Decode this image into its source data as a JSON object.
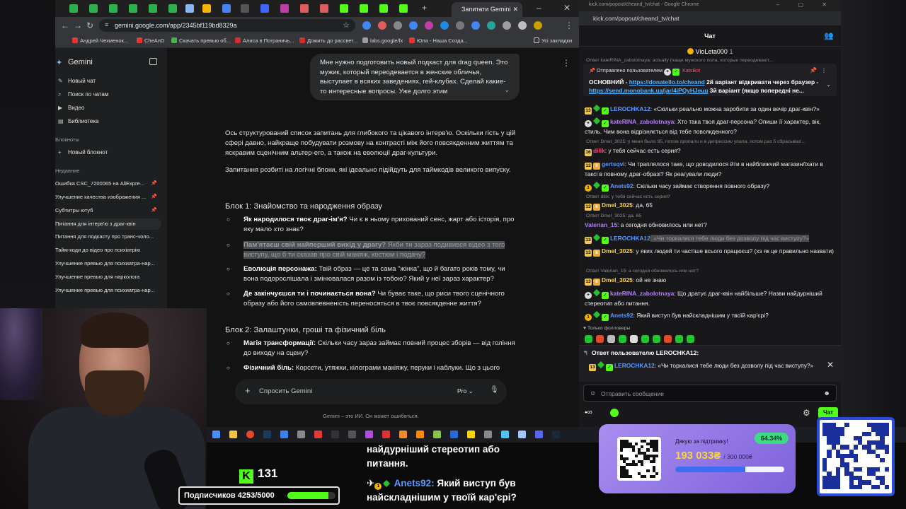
{
  "chrome": {
    "active_tab": "Запитати Gemini",
    "url": "gemini.google.com/app/2345bf119bd8329a",
    "bookmarks": [
      "Андрей Чехменок...",
      "CheAnD",
      "Скачать превью об...",
      "Алиса в Пограничь...",
      "Дожить до рассвет...",
      "labs.google/fx",
      "Юла - Наша Созда...",
      "Усі закладки"
    ]
  },
  "gemini": {
    "brand": "Gemini",
    "menu": [
      "Новый чат",
      "Поиск по чатам",
      "Видео",
      "Библиотека"
    ],
    "notebooks_title": "Блокноты",
    "new_notebook": "Новый блокнот",
    "recent_title": "Недавние",
    "recent": [
      "Ошибка CSC_7200065 на AliExpre...",
      "Улучшение качества изображения ...",
      "Субтитры ютуб",
      "Питання для інтерв'ю з драг-квін",
      "Питання для подкасту про транс-чоло...",
      "Тайм-коди до відео про психіатрію",
      "Улучшение превью для психиатра-нар...",
      "Улучшение превью для нарколога",
      "Улучшение превью для психиатра-нар..."
    ],
    "user_prompt": "Мне нужно подготовить новый подкаст для drag queen. Это мужик, который переодевается в женские обличья, выступает в всяких заведениях, гей-клубах. Сделай какие-то интересные вопросы. Уже долго этим",
    "intro": "Ось структурований список запитань для глибокого та цікавого інтерв'ю. Оскільки гість у цій сфері давно, найкраще побудувати розмову на контрасті між його повсякденним життям та яскравим сценічним альтер-его, а також на еволюції драг-культури.",
    "intro2": "Запитання розбиті на логічні блоки, які ідеально підійдуть для таймкодів великого випуску.",
    "block1_title": "Блок 1: Знайомство та народження образу",
    "block1": [
      {
        "bold": "Як народилося твоє драг-ім'я?",
        "text": " Чи є в ньому прихований сенс, жарт або історія, про яку мало хто знає?"
      },
      {
        "bold": "Пам'ятаєш свій найперший вихід у драгу?",
        "text": " Якби ти зараз подивився відео з того виступу, що б ти сказав про свій макіяж, костюм і подачу?"
      },
      {
        "bold": "Еволюція персонажа:",
        "text": " Твій образ — це та сама \"жінка\", що й багато років тому, чи вона подорослішала і змінювалася разом із тобою? Який у неї зараз характер?"
      },
      {
        "bold": "Де закінчуєшся ти і починається вона?",
        "text": " Чи буває таке, що риси твого сценічного образу або його самовпевненість переносяться в твоє повсякденне життя?"
      }
    ],
    "block2_title": "Блок 2: Залаштунки, гроші та фізичний біль",
    "block2": [
      {
        "bold": "Магія трансформації:",
        "text": " Скільки часу зараз займає повний процес зборів — від гоління до виходу на сцену?"
      },
      {
        "bold": "Фізичний біль:",
        "text": " Корсети, утяжки, кілограми макіяжу, перуки і каблуки. Що з цього"
      }
    ],
    "prompt_placeholder": "Спросить Gemini",
    "model": "Pro",
    "disclaimer": "Gemini – это ИИ. Он может ошибаться."
  },
  "kick": {
    "window_title": "kick.com/popout/cheand_tv/chat - Google Chrome",
    "url": "kick.com/popout/cheand_tv/chat",
    "header": "Чат",
    "top_user": "VioLeta000",
    "top_user_count": "1",
    "pinned_reply": "Ответ kateRINA_zabolotnaya: actually (чаще мужского пола, которые переодевают...",
    "pinned_by": "Отправлено пользователем",
    "pinned_user": "KatsBot",
    "pinned_label": "ОСНОВНИЙ -",
    "pinned_link1": "https://donatello.to/cheand",
    "pinned_mid": "2й варіант відкривати через браузер -",
    "pinned_link2": "https://send.monobank.ua/jar/4iPQyHJeuu",
    "pinned_end": "3й варіант (якщо попередні не...",
    "messages": [
      {
        "user": "LEROCHKA12",
        "color": "#5c98ff",
        "text": ": «Скільки реально можна заробити за один вечір драг-квін?»"
      },
      {
        "user": "kateRINA_zabolotnaya",
        "color": "#b57cff",
        "text": ": Хто така твоя драг-персона? Опиши її характер, вік, стиль. Чим вона відрізняється від тебе повсякденного?"
      },
      {
        "reply": "Ответ Dmel_3025: у меня было 95, потом пропало и в депрессию упала. потом раз 5 сбрасывал..."
      },
      {
        "user": "dilik",
        "color": "#ff4d6d",
        "text": ": у тебя сейчас есть серия?"
      },
      {
        "user": "gertsqvi",
        "color": "#5c98ff",
        "text": ": Чи траплялося таке, що доводилося йти в найближчий магазин/їхати в таксі в повному драг-образі? Як реагували люди?"
      },
      {
        "user": "Anets92",
        "color": "#5c98ff",
        "text": ": Скільки часу займає створення повного образу?"
      },
      {
        "reply": "Ответ dilik: у тебя сейчас есть серия?"
      },
      {
        "user": "Dmel_3025",
        "color": "#ffd24a",
        "text": ": да, 65"
      },
      {
        "reply": "Ответ Dmel_3025: да, 65"
      },
      {
        "user": "Valerian_15",
        "color": "#b57cff",
        "text": ": а сегодня обновилось или нет?"
      },
      {
        "user": "LEROCHKA12",
        "color": "#5c98ff",
        "text": ": «Чи торкалися тебе люди без дозволу під час виступу?»"
      },
      {
        "user": "Dmel_3025",
        "color": "#ffd24a",
        "text": ": у яких людей ти частіше всього працюєш? (хз як це правильно назвати)"
      },
      {
        "reply": "Ответ Valerian_15: а сегодня обновилось или нет?"
      },
      {
        "user": "Dmel_3025",
        "color": "#ffd24a",
        "text": ": ой не знаю"
      },
      {
        "user": "kateRINA_zabolotnaya",
        "color": "#b57cff",
        "text": ": Що дратує драг-квін найбільше? Назви найдурніший стереотип або питання."
      },
      {
        "user": "Anets92",
        "color": "#5c98ff",
        "text": ": Який виступ був найскладнішим у твоїй кар'єрі?"
      }
    ],
    "followers_note": "Только фолловеры",
    "reply_head": "Ответ пользователю LEROCHKA12:",
    "reply_user": "LEROCHKA12",
    "reply_text": ": «Чи торкалися тебе люди без дозволу під час виступу?»",
    "input_placeholder": "Отправить сообщение",
    "chat_button": "Чат"
  },
  "stream": {
    "followers": "131",
    "subs_label": "Подписчиков 4253/5000",
    "subs_progress": 0.8506,
    "overlay_line1": "найдурніший стереотип або",
    "overlay_line2": "питання.",
    "overlay_user": "Anets92:",
    "overlay_msg1": "Який виступ був",
    "overlay_msg2": "найскладнішим у твоїй кар'єрі?",
    "donate_thanks": "Дякую за підтримку!",
    "donate_percent": "64.34%",
    "donate_amount": "193 033₴",
    "donate_goal": "/ 300 000₴",
    "donate_progress": 0.6434
  },
  "colors": {
    "kick_green": "#53fc18",
    "gemini_bg": "#131314",
    "chat_bg": "#18181b",
    "link": "#53b4ff"
  }
}
